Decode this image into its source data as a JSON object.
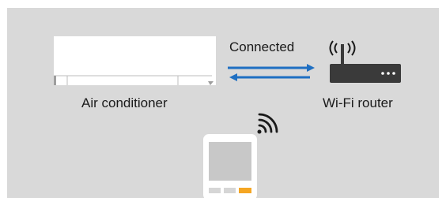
{
  "labels": {
    "connection_status": "Connected",
    "air_conditioner": "Air conditioner",
    "router": "Wi-Fi router"
  },
  "icons": {
    "air_conditioner": "air-conditioner-icon",
    "router": "wifi-router-icon",
    "router_signal": "radio-waves-icon",
    "remote_signal": "wifi-signal-icon",
    "remote": "remote-controller-icon"
  },
  "colors": {
    "panel_background": "#d9d9d9",
    "arrow_blue": "#1f6fc2",
    "router_body": "#3a3a3a",
    "remote_button_accent": "#f5a623"
  }
}
